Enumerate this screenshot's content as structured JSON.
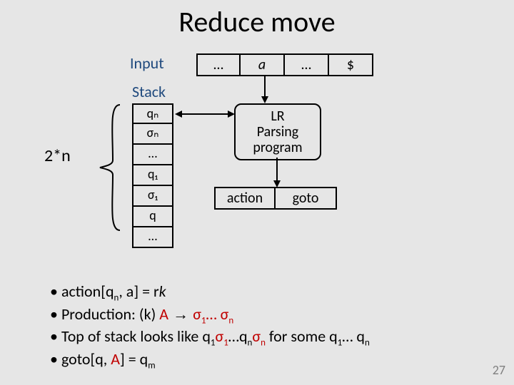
{
  "title": "Reduce move",
  "labels": {
    "input": "Input",
    "stack": "Stack",
    "twon": "2*n"
  },
  "tape": [
    "…",
    "a",
    "…",
    "$"
  ],
  "stack_cells": [
    "qₙ",
    "σₙ",
    "…",
    "q₁",
    "σ₁",
    "q",
    "…"
  ],
  "program": [
    "LR",
    "Parsing",
    "program"
  ],
  "tables": {
    "action": "action",
    "goto": "goto"
  },
  "bullets": {
    "b0_pre": "action[q",
    "b0_mid": ", a] = r",
    "b0_k": "k",
    "b1_pre": "Production: (k) ",
    "b1_A": "A",
    "b1_arrow": " → ",
    "b1_s1": "σ",
    "b1_dots": "… ",
    "b1_sn": "σ",
    "b2_pre": "Top of stack looks like q",
    "b2_s": "σ",
    "b2_mid": "…q",
    "b2_sn": "σ",
    "b2_post": "  for some q",
    "b2_rng": "… q",
    "b3_pre": "goto[q, ",
    "b3_A": "A",
    "b3_mid": "] = q"
  },
  "sub": {
    "n": "n",
    "one": "1",
    "m": "m"
  },
  "page": "27"
}
